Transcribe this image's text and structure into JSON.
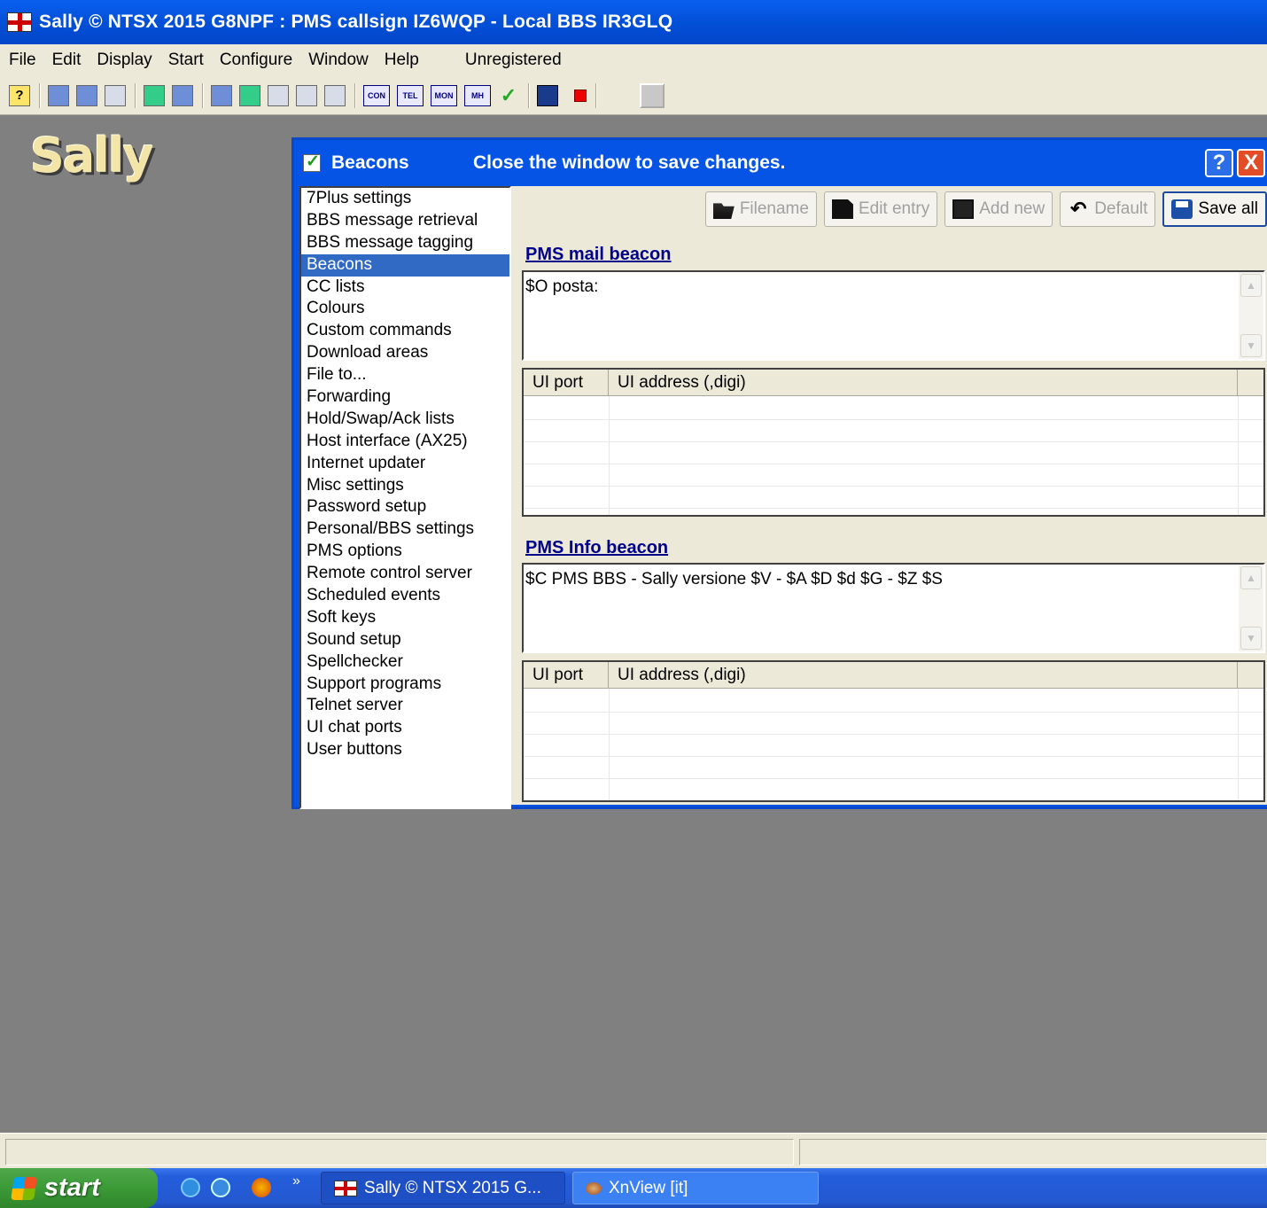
{
  "window": {
    "title": "Sally © NTSX 2015 G8NPF : PMS callsign IZ6WQP - Local BBS IR3GLQ"
  },
  "menu": {
    "items": [
      "File",
      "Edit",
      "Display",
      "Start",
      "Configure",
      "Window",
      "Help"
    ],
    "status": "Unregistered"
  },
  "toolbar": {
    "con": "CON",
    "tel": "TEL",
    "mon": "MON",
    "mh": "MH",
    "help": "?"
  },
  "logo": "Sally",
  "dialog": {
    "title": "Beacons",
    "message": "Close the window to save changes.",
    "help_label": "?",
    "close_label": "X",
    "settings_list": [
      "7Plus settings",
      "BBS message retrieval",
      "BBS message tagging",
      "Beacons",
      "CC lists",
      "Colours",
      "Custom commands",
      "Download areas",
      "File to...",
      "Forwarding",
      "Hold/Swap/Ack lists",
      "Host interface (AX25)",
      "Internet updater",
      "Misc settings",
      "Password setup",
      "Personal/BBS settings",
      "PMS options",
      "Remote control server",
      "Scheduled events",
      "Soft keys",
      "Sound setup",
      "Spellchecker",
      "Support programs",
      "Telnet server",
      "UI chat ports",
      "User buttons"
    ],
    "selected_item": "Beacons",
    "buttons": {
      "filename": "Filename",
      "edit_entry": "Edit entry",
      "add_new": "Add new",
      "default": "Default",
      "save_all": "Save all"
    },
    "mail_beacon": {
      "heading": "PMS mail beacon",
      "text": "$O posta:",
      "columns": [
        "UI port",
        "UI address (,digi)"
      ]
    },
    "info_beacon": {
      "heading": "PMS Info beacon",
      "text": "$C PMS BBS - Sally versione $V - $A $D $d $G - $Z $S",
      "columns": [
        "UI port",
        "UI address (,digi)"
      ]
    }
  },
  "taskbar": {
    "start": "start",
    "chevron": "»",
    "tasks": [
      "Sally © NTSX 2015 G...",
      "XnView [it]"
    ]
  }
}
